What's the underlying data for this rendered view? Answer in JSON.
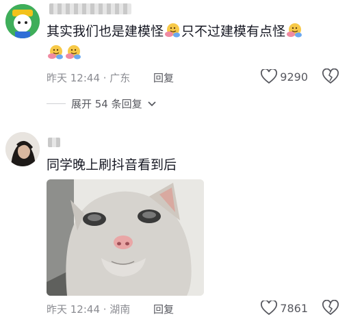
{
  "comments": [
    {
      "text_parts": [
        "其实我们也是建模怪",
        "只不过建模有点怪"
      ],
      "meta": "昨天 12:44 · 广东",
      "reply_label": "回复",
      "likes": "9290",
      "replies_label": "展开 54 条回复"
    },
    {
      "text": "同学晚上刷抖音看到后",
      "meta": "昨天 12:44 · 湖南",
      "reply_label": "回复",
      "likes": "7861"
    }
  ],
  "colors": {
    "text": "#161823",
    "meta": "#8a8b91",
    "action": "#57585f"
  },
  "icons": [
    "heart-icon",
    "broken-heart-icon",
    "chevron-down-icon",
    "hug-emoji-icon"
  ]
}
